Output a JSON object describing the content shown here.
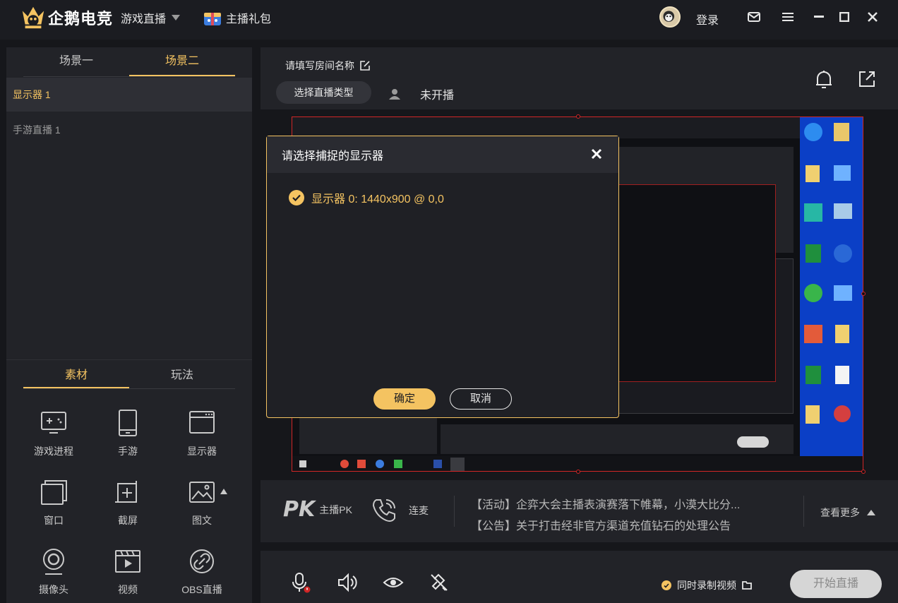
{
  "app": {
    "logo_text": "企鹅电竞",
    "nav_game_live": "游戏直播",
    "nav_gift": "主播礼包",
    "login": "登录"
  },
  "scenes": {
    "tabs": [
      "场景一",
      "场景二"
    ],
    "active_tab": 1,
    "sources": [
      "显示器 1",
      "手游直播 1"
    ]
  },
  "materials": {
    "tabs": [
      "素材",
      "玩法"
    ],
    "items": [
      "游戏进程",
      "手游",
      "显示器",
      "窗口",
      "截屏",
      "图文",
      "摄像头",
      "视频",
      "OBS直播"
    ]
  },
  "room": {
    "name_placeholder": "请填写房间名称",
    "type_button": "选择直播类型",
    "status": "未开播"
  },
  "dialog": {
    "title": "请选择捕捉的显示器",
    "option": "显示器 0: 1440x900 @ 0,0",
    "ok": "确定",
    "cancel": "取消"
  },
  "interact": {
    "pk_big": "PK",
    "pk_label": "主播PK",
    "lianmai": "连麦",
    "notice1": "【活动】企弈大会主播表演赛落下帷幕，小漠大比分...",
    "notice2": "【公告】关于打击经非官方渠道充值钻石的处理公告",
    "more": "查看更多"
  },
  "bottom": {
    "record": "同时录制视频",
    "start": "开始直播"
  },
  "colors": {
    "accent": "#f4c361",
    "panel": "#222328",
    "preview_border": "#d12626"
  }
}
